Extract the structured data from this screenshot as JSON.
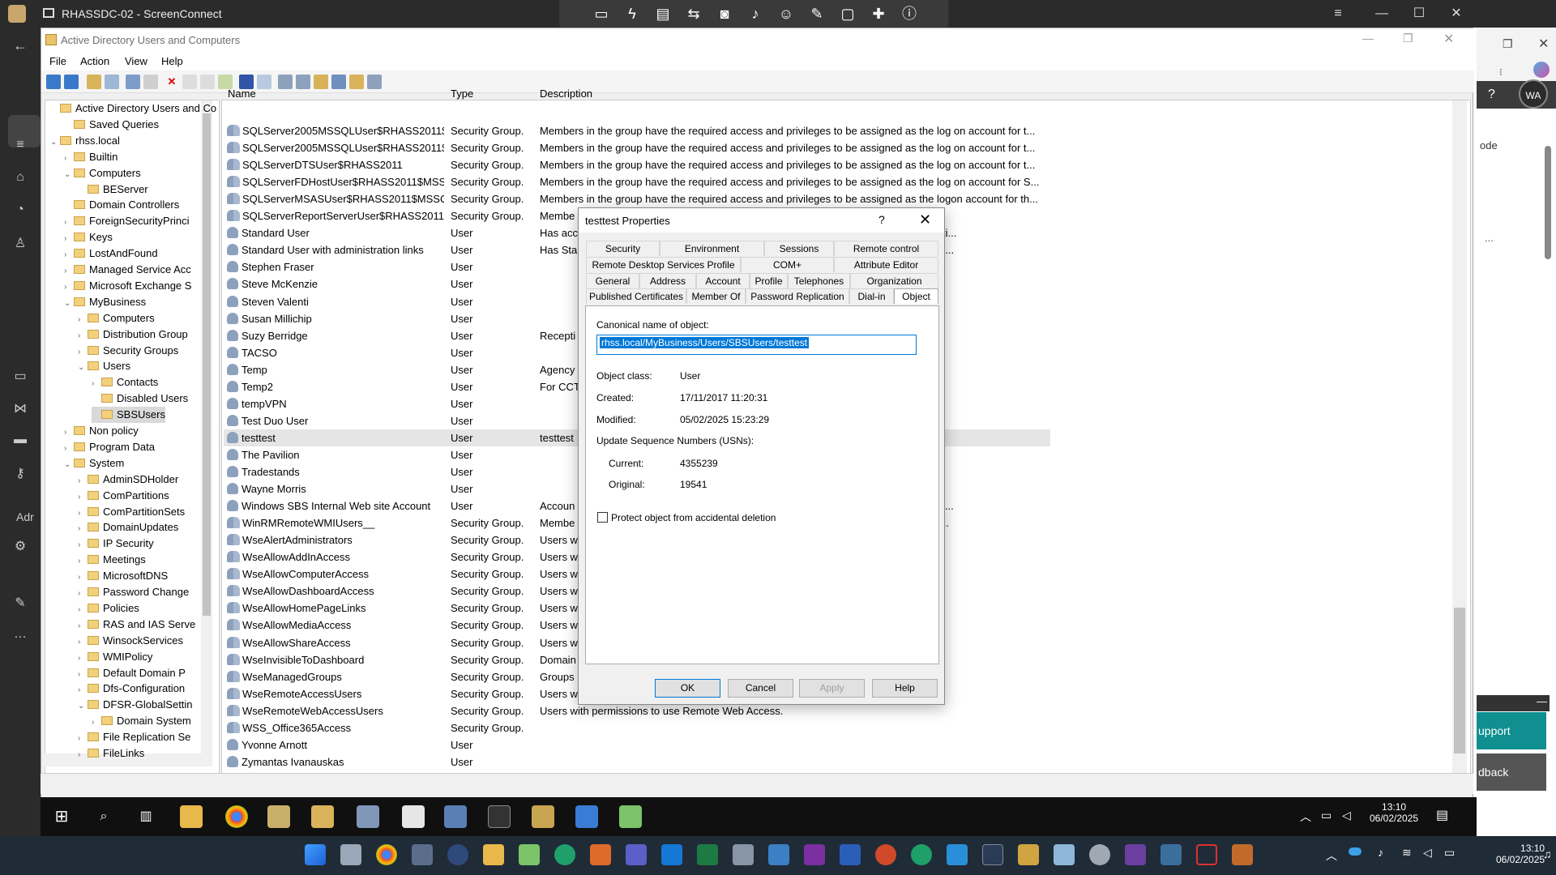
{
  "screenconnect": {
    "title": "RHASSDC-02 - ScreenConnect",
    "toolbar_icons": [
      "monitor-icon",
      "lightning-icon",
      "toolbox-icon",
      "swap-icon",
      "camera-icon",
      "microphone-icon",
      "people-icon",
      "pen-icon",
      "chat-icon",
      "plus-cross-icon",
      "info-icon"
    ]
  },
  "edge": {
    "avatar": "WA",
    "partial_text": "ode",
    "ellipsis": "...",
    "support": "upport",
    "feedback": "dback",
    "adm": "Adr"
  },
  "aduc": {
    "title": "Active Directory Users and Computers",
    "menu": [
      "File",
      "Action",
      "View",
      "Help"
    ],
    "tree": [
      {
        "label": "Active Directory Users and Co",
        "indent": 0,
        "exp": ""
      },
      {
        "label": "Saved Queries",
        "indent": 1,
        "exp": ""
      },
      {
        "label": "rhss.local",
        "indent": 0,
        "exp": "v"
      },
      {
        "label": "Builtin",
        "indent": 1,
        "exp": ">"
      },
      {
        "label": "Computers",
        "indent": 1,
        "exp": "v"
      },
      {
        "label": "BEServer",
        "indent": 2,
        "exp": ""
      },
      {
        "label": "Domain Controllers",
        "indent": 1,
        "exp": ""
      },
      {
        "label": "ForeignSecurityPrinci",
        "indent": 1,
        "exp": ">"
      },
      {
        "label": "Keys",
        "indent": 1,
        "exp": ">"
      },
      {
        "label": "LostAndFound",
        "indent": 1,
        "exp": ">"
      },
      {
        "label": "Managed Service Acc",
        "indent": 1,
        "exp": ">"
      },
      {
        "label": "Microsoft Exchange S",
        "indent": 1,
        "exp": ">"
      },
      {
        "label": "MyBusiness",
        "indent": 1,
        "exp": "v"
      },
      {
        "label": "Computers",
        "indent": 2,
        "exp": ">"
      },
      {
        "label": "Distribution Group",
        "indent": 2,
        "exp": ">"
      },
      {
        "label": "Security Groups",
        "indent": 2,
        "exp": ">"
      },
      {
        "label": "Users",
        "indent": 2,
        "exp": "v"
      },
      {
        "label": "Contacts",
        "indent": 3,
        "exp": ">"
      },
      {
        "label": "Disabled Users",
        "indent": 3,
        "exp": ""
      },
      {
        "label": "SBSUsers",
        "indent": 3,
        "exp": ""
      },
      {
        "label": "Non policy",
        "indent": 1,
        "exp": ">"
      },
      {
        "label": "Program Data",
        "indent": 1,
        "exp": ">"
      },
      {
        "label": "System",
        "indent": 1,
        "exp": "v"
      },
      {
        "label": "AdminSDHolder",
        "indent": 2,
        "exp": ">"
      },
      {
        "label": "ComPartitions",
        "indent": 2,
        "exp": ">"
      },
      {
        "label": "ComPartitionSets",
        "indent": 2,
        "exp": ">"
      },
      {
        "label": "DomainUpdates",
        "indent": 2,
        "exp": ">"
      },
      {
        "label": "IP Security",
        "indent": 2,
        "exp": ">"
      },
      {
        "label": "Meetings",
        "indent": 2,
        "exp": ">"
      },
      {
        "label": "MicrosoftDNS",
        "indent": 2,
        "exp": ">"
      },
      {
        "label": "Password Change",
        "indent": 2,
        "exp": ">"
      },
      {
        "label": "Policies",
        "indent": 2,
        "exp": ">"
      },
      {
        "label": "RAS and IAS Serve",
        "indent": 2,
        "exp": ">"
      },
      {
        "label": "WinsockServices",
        "indent": 2,
        "exp": ">"
      },
      {
        "label": "WMIPolicy",
        "indent": 2,
        "exp": ">"
      },
      {
        "label": "Default Domain P",
        "indent": 2,
        "exp": ">"
      },
      {
        "label": "Dfs-Configuration",
        "indent": 2,
        "exp": ">"
      },
      {
        "label": "DFSR-GlobalSettin",
        "indent": 2,
        "exp": "v"
      },
      {
        "label": "Domain System",
        "indent": 3,
        "exp": ">"
      },
      {
        "label": "File Replication Se",
        "indent": 2,
        "exp": ">"
      },
      {
        "label": "FileLinks",
        "indent": 2,
        "exp": ">"
      }
    ],
    "columns": {
      "name": "Name",
      "type": "Type",
      "description": "Description"
    },
    "rows": [
      {
        "name": "SQLServer2005MSSQLUser$RHASS2011$...",
        "type": "Security Group...",
        "desc": "Members in the group have the required access and privileges to be assigned as the log on account for t...",
        "kind": "group"
      },
      {
        "name": "SQLServer2005MSSQLUser$RHASS2011$...",
        "type": "Security Group...",
        "desc": "Members in the group have the required access and privileges to be assigned as the log on account for t...",
        "kind": "group"
      },
      {
        "name": "SQLServerDTSUser$RHASS2011",
        "type": "Security Group...",
        "desc": "Members in the group have the required access and privileges to be assigned as the log on account for t...",
        "kind": "group"
      },
      {
        "name": "SQLServerFDHostUser$RHASS2011$MSS...",
        "type": "Security Group...",
        "desc": "Members in the group have the required access and privileges to be assigned as the log on account for S...",
        "kind": "group"
      },
      {
        "name": "SQLServerMSASUser$RHASS2011$MSSQ...",
        "type": "Security Group...",
        "desc": "Members in the group have the required access and privileges to be assigned as the logon account for th...",
        "kind": "group"
      },
      {
        "name": "SQLServerReportServerUser$RHASS2011$...",
        "type": "Security Group...",
        "desc": "Membe                                                                                          on account for t...",
        "kind": "group"
      },
      {
        "name": "Standard User",
        "type": "User",
        "desc": "Has acc                                                                                                  arePoint Foundati...",
        "kind": "user"
      },
      {
        "name": "Standard User with administration links",
        "type": "User",
        "desc": "Has Sta                                                                                              te Web Access and ...",
        "kind": "user"
      },
      {
        "name": "Stephen Fraser",
        "type": "User",
        "desc": "",
        "kind": "user"
      },
      {
        "name": "Steve McKenzie",
        "type": "User",
        "desc": "",
        "kind": "user"
      },
      {
        "name": "Steven Valenti",
        "type": "User",
        "desc": "",
        "kind": "user"
      },
      {
        "name": "Susan Millichip",
        "type": "User",
        "desc": "",
        "kind": "user"
      },
      {
        "name": "Suzy Berridge",
        "type": "User",
        "desc": "Recepti",
        "kind": "user"
      },
      {
        "name": "TACSO",
        "type": "User",
        "desc": "",
        "kind": "user"
      },
      {
        "name": "Temp",
        "type": "User",
        "desc": "Agency",
        "kind": "user"
      },
      {
        "name": "Temp2",
        "type": "User",
        "desc": "For CCT",
        "kind": "user"
      },
      {
        "name": "tempVPN",
        "type": "User",
        "desc": "",
        "kind": "user"
      },
      {
        "name": "Test Duo User",
        "type": "User",
        "desc": "",
        "kind": "user"
      },
      {
        "name": "testtest",
        "type": "User",
        "desc": "testtest",
        "kind": "user",
        "selected": true
      },
      {
        "name": "The Pavilion",
        "type": "User",
        "desc": "",
        "kind": "user"
      },
      {
        "name": "Tradestands",
        "type": "User",
        "desc": "",
        "kind": "user"
      },
      {
        "name": "Wayne Morris",
        "type": "User",
        "desc": "",
        "kind": "user"
      },
      {
        "name": "Windows SBS Internal Web site Account",
        "type": "User",
        "desc": "Accoun                                                                                               able or delete this a...",
        "kind": "user"
      },
      {
        "name": "WinRMRemoteWMIUsers__",
        "type": "Security Group...",
        "desc": "Membe                                                                                               s WS-Managemen...",
        "kind": "group"
      },
      {
        "name": "WseAlertAdministrators",
        "type": "Security Group...",
        "desc": "Users w",
        "kind": "group"
      },
      {
        "name": "WseAllowAddInAccess",
        "type": "Security Group...",
        "desc": "Users w",
        "kind": "group"
      },
      {
        "name": "WseAllowComputerAccess",
        "type": "Security Group...",
        "desc": "Users w",
        "kind": "group"
      },
      {
        "name": "WseAllowDashboardAccess",
        "type": "Security Group...",
        "desc": "Users w",
        "kind": "group"
      },
      {
        "name": "WseAllowHomePageLinks",
        "type": "Security Group...",
        "desc": "Users w",
        "kind": "group"
      },
      {
        "name": "WseAllowMediaAccess",
        "type": "Security Group...",
        "desc": "Users w",
        "kind": "group"
      },
      {
        "name": "WseAllowShareAccess",
        "type": "Security Group...",
        "desc": "Users w",
        "kind": "group"
      },
      {
        "name": "WseInvisibleToDashboard",
        "type": "Security Group...",
        "desc": "Domain",
        "kind": "group"
      },
      {
        "name": "WseManagedGroups",
        "type": "Security Group...",
        "desc": "Groups",
        "kind": "group"
      },
      {
        "name": "WseRemoteAccessUsers",
        "type": "Security Group...",
        "desc": "Users w",
        "kind": "group"
      },
      {
        "name": "WseRemoteWebAccessUsers",
        "type": "Security Group...",
        "desc": "Users with permissions to use Remote Web Access.",
        "kind": "group"
      },
      {
        "name": "WSS_Office365Access",
        "type": "Security Group...",
        "desc": "",
        "kind": "group"
      },
      {
        "name": "Yvonne Arnott",
        "type": "User",
        "desc": "",
        "kind": "user"
      },
      {
        "name": "Zymantas Ivanauskas",
        "type": "User",
        "desc": "",
        "kind": "user"
      }
    ]
  },
  "dialog": {
    "title": "testtest Properties",
    "help": "?",
    "close": "✕",
    "tabs_row1": [
      "Security",
      "Environment",
      "Sessions",
      "Remote control"
    ],
    "tabs_row2": [
      "Remote Desktop Services Profile",
      "COM+",
      "Attribute Editor"
    ],
    "tabs_row3": [
      "General",
      "Address",
      "Account",
      "Profile",
      "Telephones",
      "Organization"
    ],
    "tabs_row4": [
      "Published Certificates",
      "Member Of",
      "Password Replication",
      "Dial-in",
      "Object"
    ],
    "canonical_label": "Canonical name of object:",
    "canonical_value": "rhss.local/MyBusiness/Users/SBSUsers/testtest",
    "object_class_label": "Object class:",
    "object_class": "User",
    "created_label": "Created:",
    "created": "17/11/2017 11:20:31",
    "modified_label": "Modified:",
    "modified": "05/02/2025 15:23:29",
    "usn_label": "Update Sequence Numbers (USNs):",
    "current_label": "Current:",
    "current": "4355239",
    "original_label": "Original:",
    "original": "19541",
    "protect_label": "Protect object from accidental deletion",
    "ok": "OK",
    "cancel": "Cancel",
    "apply": "Apply",
    "help_btn": "Help"
  },
  "inner_clock": {
    "time": "13:10",
    "date": "06/02/2025"
  },
  "outer_clock": {
    "time": "13:10",
    "date": "06/02/2025"
  },
  "colors": {
    "accent": "#0078d7",
    "taskbar": "#101010",
    "outer_taskbar": "#202b38",
    "support": "#0f8f8f"
  }
}
